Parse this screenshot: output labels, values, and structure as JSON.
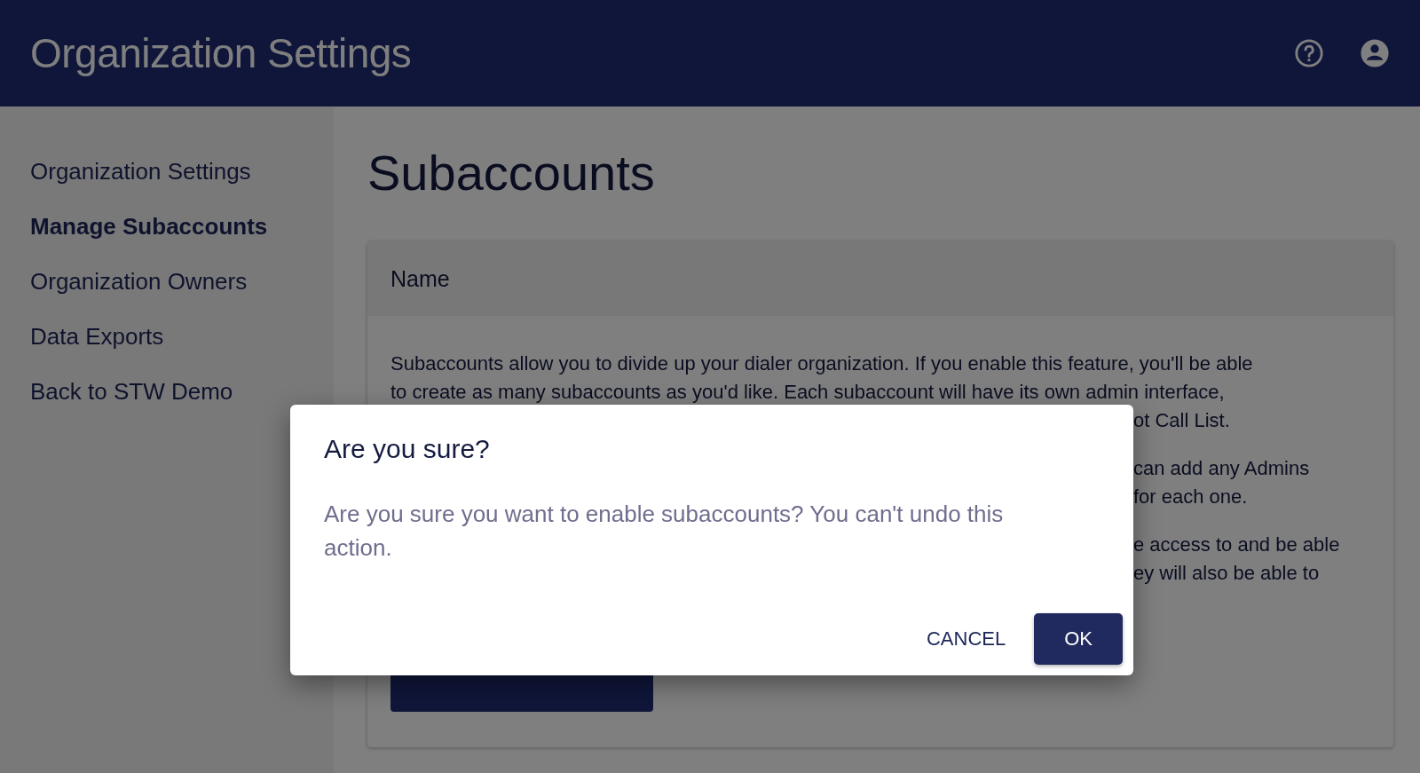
{
  "header": {
    "title": "Organization Settings"
  },
  "sidebar": {
    "items": [
      {
        "label": "Organization Settings",
        "selected": false
      },
      {
        "label": "Manage Subaccounts",
        "selected": true
      },
      {
        "label": "Organization Owners",
        "selected": false
      },
      {
        "label": "Data Exports",
        "selected": false
      },
      {
        "label": "Back to STW Demo",
        "selected": false
      }
    ]
  },
  "main": {
    "title": "Subaccounts",
    "card": {
      "column_header": "Name",
      "paragraphs": [
        {
          "lines": [
            {
              "text": "Subaccounts allow you to divide up your dialer organization. If you enable this feature, you'll be able",
              "clipped": false
            },
            {
              "text": "to create as many subaccounts as you'd like. Each subaccount will have its own admin interface,",
              "clipped": false
            },
            {
              "text": "ot Call List.",
              "clipped": true
            }
          ]
        },
        {
          "lines": [
            {
              "text": "can add any Admins",
              "clipped": true
            },
            {
              "text": "for each one.",
              "clipped": true
            }
          ]
        },
        {
          "lines": [
            {
              "text": "e access to and be able",
              "clipped": true
            },
            {
              "text": "ey will also be able to",
              "clipped": true
            }
          ]
        }
      ]
    }
  },
  "dialog": {
    "title": "Are you sure?",
    "message": "Are you sure you want to enable subaccounts? You can't undo this action.",
    "buttons": [
      {
        "label": "CANCEL",
        "kind": "text"
      },
      {
        "label": "OK",
        "kind": "primary"
      }
    ]
  }
}
